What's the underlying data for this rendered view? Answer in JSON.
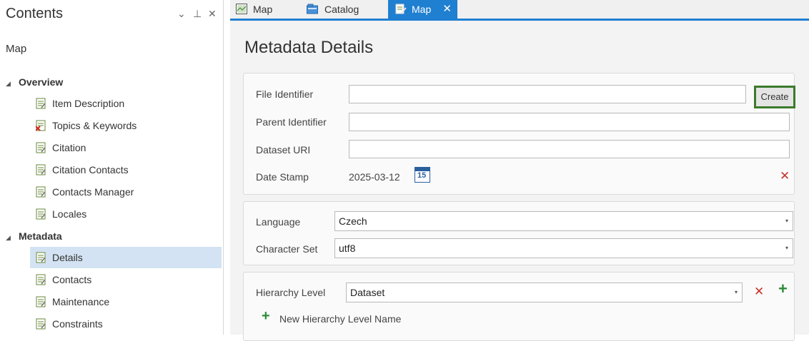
{
  "contents_pane": {
    "title": "Contents",
    "dropdown_glyph": "⌄",
    "pin_glyph": "⊥",
    "close_glyph": "✕",
    "map_label": "Map",
    "overview": {
      "label": "Overview",
      "items": [
        {
          "label": "Item Description",
          "icon": "metadata-page-icon"
        },
        {
          "label": "Topics & Keywords",
          "icon": "metadata-page-error-icon"
        },
        {
          "label": "Citation",
          "icon": "metadata-page-icon"
        },
        {
          "label": "Citation Contacts",
          "icon": "metadata-page-icon"
        },
        {
          "label": "Contacts Manager",
          "icon": "metadata-page-icon"
        },
        {
          "label": "Locales",
          "icon": "metadata-page-icon"
        }
      ]
    },
    "metadata": {
      "label": "Metadata",
      "items": [
        {
          "label": "Details",
          "icon": "metadata-page-icon",
          "selected": true
        },
        {
          "label": "Contacts",
          "icon": "metadata-page-icon"
        },
        {
          "label": "Maintenance",
          "icon": "metadata-page-icon"
        },
        {
          "label": "Constraints",
          "icon": "metadata-page-icon"
        }
      ]
    }
  },
  "tabs": [
    {
      "label": "Map",
      "icon": "map-icon",
      "active": false
    },
    {
      "label": "Catalog",
      "icon": "catalog-icon",
      "active": false
    },
    {
      "label": "Map",
      "icon": "metadata-edit-icon",
      "active": true,
      "close": "✕"
    }
  ],
  "main": {
    "title": "Metadata Details",
    "identification": {
      "file_identifier_label": "File Identifier",
      "file_identifier_value": "",
      "create_label": "Create",
      "parent_identifier_label": "Parent Identifier",
      "parent_identifier_value": "",
      "dataset_uri_label": "Dataset URI",
      "dataset_uri_value": "",
      "date_stamp_label": "Date Stamp",
      "date_stamp_value": "2025-03-12",
      "calendar_day": "15",
      "clear_glyph": "✕"
    },
    "locale": {
      "language_label": "Language",
      "language_value": "Czech",
      "charset_label": "Character Set",
      "charset_value": "utf8",
      "dropdown_glyph": "▾"
    },
    "hierarchy": {
      "hierarchy_label": "Hierarchy Level",
      "hierarchy_value": "Dataset",
      "remove_glyph": "✕",
      "add_glyph": "+",
      "new_name_label": "New Hierarchy Level Name"
    }
  },
  "colors": {
    "accent": "#1f7fd1",
    "selection": "#d3e3f3",
    "create_border": "#3b7a2d",
    "error": "#c8332a",
    "add": "#2e8b3a"
  }
}
